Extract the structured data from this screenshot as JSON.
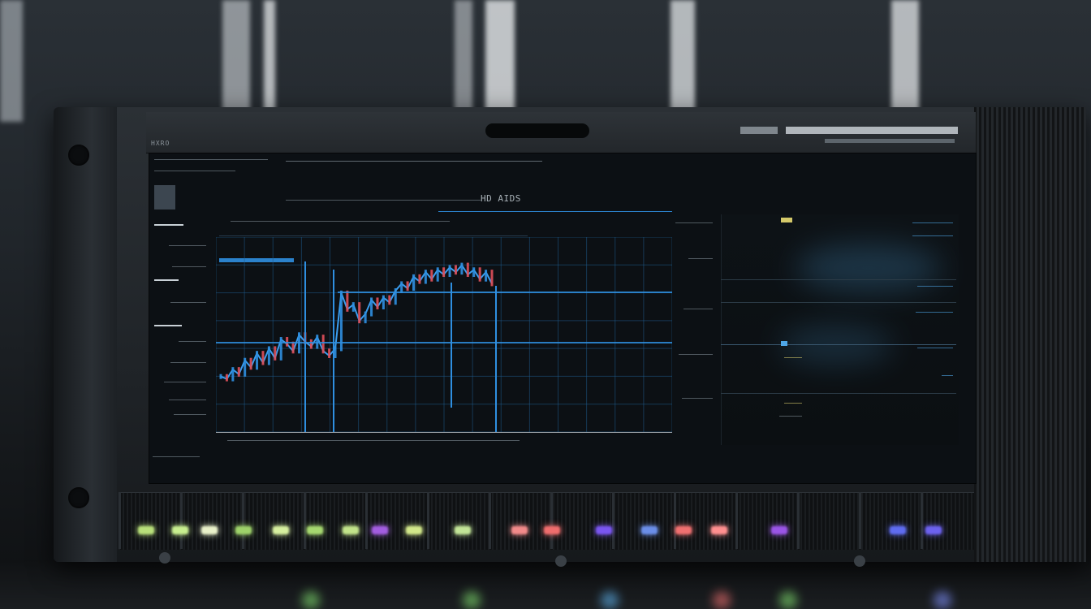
{
  "device": {
    "top_brand": "HXRO",
    "header_text": "HD AIDS"
  },
  "screen": {
    "chart": {
      "type": "line",
      "price_series": [
        38,
        36,
        44,
        40,
        52,
        46,
        58,
        50,
        62,
        54,
        70,
        66,
        60,
        74,
        68,
        64,
        72,
        60,
        56,
        62,
        110,
        96,
        100,
        86,
        92,
        104,
        98,
        106,
        102,
        112,
        118,
        114,
        124,
        120,
        128,
        122,
        130,
        126,
        132,
        128,
        134,
        126,
        130,
        122,
        128,
        118
      ]
    }
  },
  "leds": [
    {
      "color": "#b8e07a"
    },
    {
      "color": "#c8ef8f"
    },
    {
      "color": "#e9f1c9"
    },
    {
      "color": "#9ed26a"
    },
    {
      "color": "#d7f09f"
    },
    {
      "color": "#a6d86f"
    },
    {
      "color": "#c2e48a"
    },
    {
      "color": "#a35de0"
    },
    {
      "color": "#d2e88a"
    },
    {
      "color": "#c2e597"
    },
    {
      "color": "#f28a8a"
    },
    {
      "color": "#ef6d6d"
    },
    {
      "color": "#7a56f0"
    },
    {
      "color": "#6b8ee8"
    },
    {
      "color": "#f07070"
    },
    {
      "color": "#ff8f8f"
    },
    {
      "color": "#9a55e6"
    },
    {
      "color": "#5f6cf0"
    },
    {
      "color": "#6d62ef"
    }
  ],
  "colors": {
    "accent_blue": "#2f8fe0",
    "grid": "#1e5a8a",
    "candle_red": "#e0505a",
    "screen_bg": "#0c1014"
  }
}
